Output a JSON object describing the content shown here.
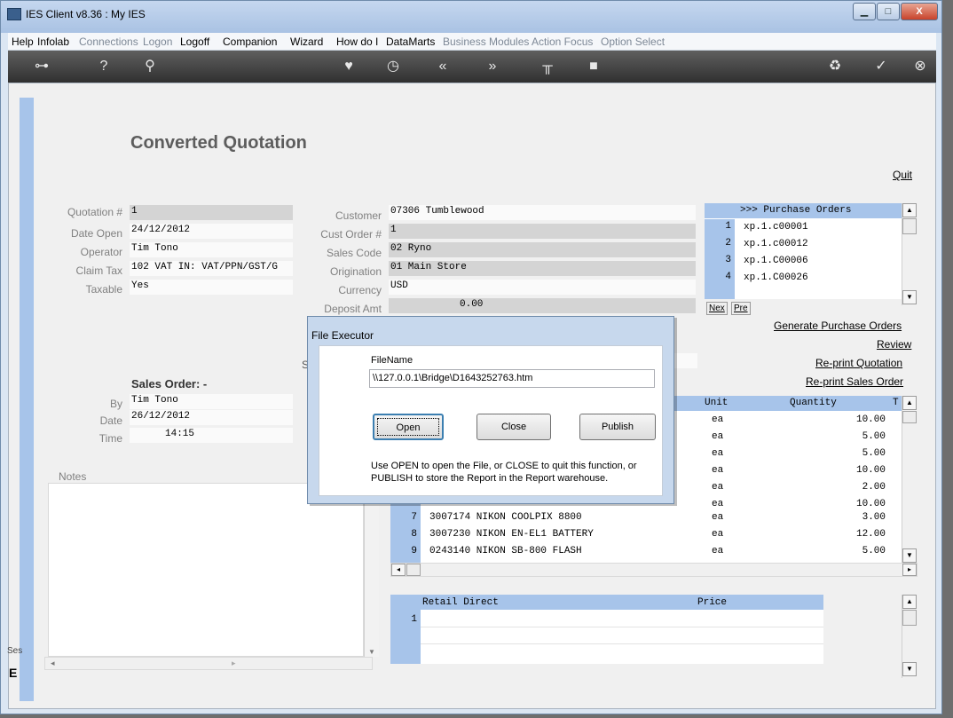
{
  "window": {
    "title": "IES Client v8.36 : My IES",
    "min_glyph": "▁",
    "max_glyph": "□",
    "close_glyph": "X"
  },
  "menu": [
    "Help",
    "Infolab",
    "Connections",
    "Logon",
    "Logoff",
    "Companion",
    "Wizard",
    "How do I",
    "DataMarts",
    "Business Modules",
    "Action Focus",
    "Option Select"
  ],
  "toolbar": {
    "key": "⊶",
    "help": "?",
    "search": "⚲",
    "heart": "♥",
    "clock": "◷",
    "back": "«",
    "forward": "»",
    "tools": "╥",
    "page": "■",
    "recycle": "♻",
    "check": "✓",
    "close": "⊗"
  },
  "page": {
    "title": "Converted Quotation",
    "quit": "Quit",
    "side_label": "Ses",
    "side_glyph": "E",
    "notes_label": "Notes"
  },
  "quote": {
    "quotation_no_label": "Quotation #",
    "quotation_no": "1",
    "date_open_label": "Date Open",
    "date_open": "24/12/2012",
    "operator_label": "Operator",
    "operator": "Tim Tono",
    "claim_tax_label": "Claim Tax",
    "claim_tax": "102 VAT IN: VAT/PPN/GST/G",
    "taxable_label": "Taxable",
    "taxable": "Yes"
  },
  "customer": {
    "customer_label": "Customer",
    "customer": "07306 Tumblewood",
    "cust_order_label": "Cust Order #",
    "cust_order": "1",
    "sales_code_label": "Sales Code",
    "sales_code": "02 Ryno",
    "origination_label": "Origination",
    "origination": "01 Main Store",
    "currency_label": "Currency",
    "currency": "USD",
    "deposit_label": "Deposit Amt",
    "deposit": "0.00",
    "s_label": "S"
  },
  "sales_order": {
    "title": "Sales Order: -",
    "by_label": "By",
    "by": "Tim Tono",
    "date_label": "Date",
    "date": "26/12/2012",
    "time_label": "Time",
    "time": "14:15"
  },
  "purchase_orders": {
    "header": ">>> Purchase Orders",
    "rows": [
      {
        "n": "1",
        "v": "xp.1.c00001"
      },
      {
        "n": "2",
        "v": "xp.1.c00012"
      },
      {
        "n": "3",
        "v": "xp.1.C00006"
      },
      {
        "n": "4",
        "v": "xp.1.C00026"
      }
    ],
    "next": "Nex",
    "prev": "Pre"
  },
  "actions": {
    "generate": "Generate Purchase Orders",
    "review": "Review",
    "reprint_quote": "Re-print Quotation",
    "reprint_so": "Re-print Sales Order"
  },
  "lines": {
    "col_unit": "Unit",
    "col_qty": "Quantity",
    "col_t": "T",
    "rows": [
      {
        "n": "",
        "item": "",
        "unit": "ea",
        "qty": "10.00"
      },
      {
        "n": "",
        "item": "",
        "unit": "ea",
        "qty": "5.00"
      },
      {
        "n": "",
        "item": "",
        "unit": "ea",
        "qty": "5.00"
      },
      {
        "n": "",
        "item": "",
        "unit": "ea",
        "qty": "10.00"
      },
      {
        "n": "",
        "item": "",
        "unit": "ea",
        "qty": "2.00"
      },
      {
        "n": "",
        "item": "",
        "unit": "ea",
        "qty": "10.00"
      },
      {
        "n": "7",
        "item": "3007174 NIKON COOLPIX 8800",
        "unit": "ea",
        "qty": "3.00"
      },
      {
        "n": "8",
        "item": "3007230 NIKON EN-EL1 BATTERY",
        "unit": "ea",
        "qty": "12.00"
      },
      {
        "n": "9",
        "item": "0243140 NIKON SB-800 FLASH",
        "unit": "ea",
        "qty": "5.00"
      }
    ]
  },
  "retail": {
    "col_name": "Retail Direct",
    "col_price": "Price",
    "row1": "1"
  },
  "dialog": {
    "title": "File Executor",
    "filename_label": "FileName",
    "filename": "\\\\127.0.0.1\\Bridge\\D1643252763.htm",
    "open": "Open",
    "close": "Close",
    "publish": "Publish",
    "hint": "Use OPEN to open the File, or CLOSE to quit this function, or PUBLISH to store the Report in the Report warehouse."
  },
  "colors": {
    "accent_blue": "#a7c4ea",
    "toolbar_dark": "#3a3a3a"
  }
}
